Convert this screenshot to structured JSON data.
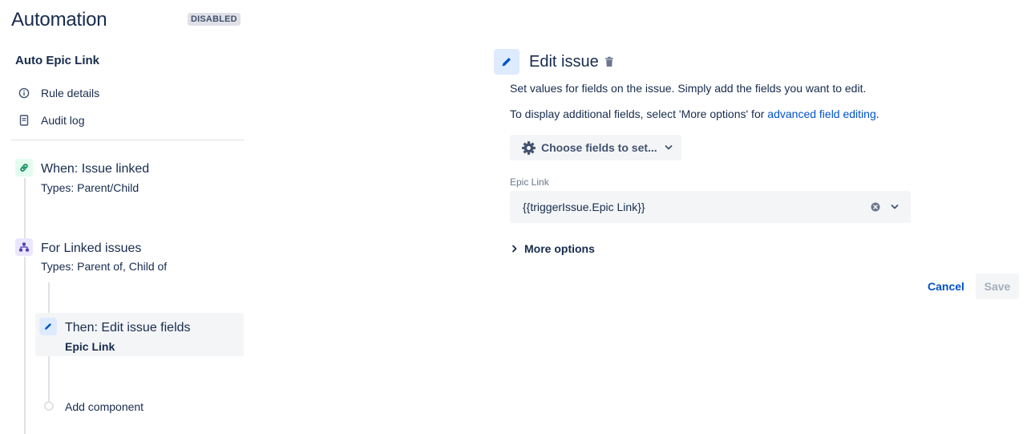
{
  "header": {
    "title": "Automation",
    "status": "DISABLED"
  },
  "rule": {
    "name": "Auto Epic Link",
    "links": [
      {
        "label": "Rule details",
        "icon": "info-icon"
      },
      {
        "label": "Audit log",
        "icon": "document-icon"
      }
    ]
  },
  "steps": {
    "trigger": {
      "title": "When: Issue linked",
      "subtitle": "Types: Parent/Child",
      "icon": "link-icon",
      "color": "#00875A",
      "badge_bg": "#E3FCEF"
    },
    "branch": {
      "title": "For Linked issues",
      "subtitle": "Types: Parent of, Child of",
      "icon": "hierarchy-icon",
      "color": "#5243AA",
      "badge_bg": "#EAE6FF"
    },
    "action": {
      "title": "Then: Edit issue fields",
      "subtitle": "Epic Link",
      "icon": "pencil-icon",
      "color": "#0052CC",
      "badge_bg": "#DEEBFF"
    },
    "add": {
      "label": "Add component"
    }
  },
  "panel": {
    "title": "Edit issue",
    "description_1": "Set values for fields on the issue. Simply add the fields you want to edit.",
    "description_2_prefix": "To display additional fields, select 'More options' for ",
    "description_2_link": "advanced field editing",
    "description_2_suffix": ".",
    "choose_fields_label": "Choose fields to set...",
    "field": {
      "label": "Epic Link",
      "value": "{{triggerIssue.Epic Link}}"
    },
    "more_options_label": "More options",
    "cancel_label": "Cancel",
    "save_label": "Save"
  },
  "colors": {
    "text": "#172B4D",
    "link": "#0052CC",
    "subtle_bg": "#F4F5F7",
    "border": "#DFE1E6"
  }
}
